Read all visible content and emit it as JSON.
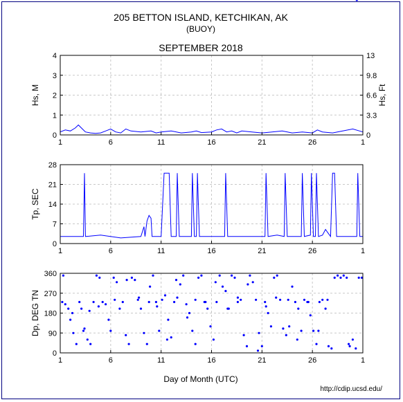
{
  "header": {
    "station": "205 BETTON ISLAND, KETCHIKAN, AK",
    "subtitle": "(BUOY)",
    "month": "SEPTEMBER 2018"
  },
  "footer": {
    "xlabel": "Day of Month (UTC)",
    "url": "http://cdip.ucsd.edu/"
  },
  "colors": {
    "series": "#0000ff",
    "grid": "#c8c8c8",
    "frame": "#000080"
  },
  "chart_data": [
    {
      "type": "line",
      "name": "hs",
      "ylabel": "Hs, M",
      "ylabel_right": "Hs, Ft",
      "ylim": [
        0,
        4
      ],
      "yticks": [
        "0",
        "1",
        "2",
        "3",
        "4"
      ],
      "yticks_right": [
        "0",
        "3.3",
        "6.6",
        "9.8",
        "13"
      ],
      "xlim": [
        1,
        31
      ],
      "xticks": [
        "1",
        "6",
        "11",
        "16",
        "21",
        "26",
        "1"
      ],
      "grid": true,
      "x": [
        1,
        1.5,
        2,
        2.5,
        2.8,
        3.2,
        3.5,
        4,
        4.5,
        5,
        5.5,
        6,
        6.5,
        7,
        7.5,
        8,
        9,
        10,
        10.5,
        11,
        12,
        13,
        14,
        14.5,
        15,
        16,
        16.5,
        17,
        17.5,
        18,
        18.5,
        19,
        20,
        21,
        22,
        23,
        24,
        25,
        26,
        26.5,
        27,
        28,
        29,
        30,
        31
      ],
      "y": [
        0.15,
        0.25,
        0.2,
        0.35,
        0.5,
        0.3,
        0.15,
        0.1,
        0.08,
        0.1,
        0.2,
        0.3,
        0.15,
        0.1,
        0.3,
        0.2,
        0.15,
        0.2,
        0.1,
        0.15,
        0.2,
        0.1,
        0.15,
        0.2,
        0.12,
        0.15,
        0.25,
        0.3,
        0.15,
        0.2,
        0.1,
        0.2,
        0.15,
        0.1,
        0.15,
        0.2,
        0.1,
        0.15,
        0.1,
        0.25,
        0.15,
        0.1,
        0.2,
        0.3,
        0.15
      ]
    },
    {
      "type": "line",
      "name": "tp",
      "ylabel": "Tp, SEC",
      "ylim": [
        0,
        28
      ],
      "yticks": [
        "0",
        "7",
        "14",
        "21",
        "28"
      ],
      "xlim": [
        1,
        31
      ],
      "xticks": [
        "1",
        "6",
        "11",
        "16",
        "21",
        "26",
        "1"
      ],
      "grid": true,
      "x": [
        1,
        3.3,
        3.4,
        3.5,
        5,
        7,
        9,
        9.3,
        9.4,
        9.6,
        9.8,
        10,
        10.1,
        10.3,
        11,
        11.3,
        11.4,
        11.6,
        11.8,
        12,
        12.5,
        12.6,
        12.8,
        13.5,
        14,
        14.1,
        14.3,
        14.5,
        14.6,
        14.8,
        16,
        17.3,
        17.4,
        17.6,
        19,
        21,
        21.3,
        21.4,
        21.6,
        22.5,
        23.2,
        23.3,
        23.5,
        24.2,
        24.5,
        24.9,
        25,
        25.2,
        25.8,
        25.9,
        26.1,
        26.3,
        26.4,
        26.6,
        27,
        27.3,
        27.5,
        27.8,
        28,
        28.1,
        28.2,
        28.4,
        29.5,
        30.4,
        30.5,
        30.7,
        31
      ],
      "y": [
        2.5,
        2.5,
        25,
        2.5,
        3,
        2,
        2.5,
        6,
        2.5,
        8,
        10,
        9,
        2.5,
        2.5,
        2.5,
        25,
        25,
        25,
        25,
        2.5,
        2.5,
        25,
        2.5,
        2.5,
        2.5,
        25,
        2.5,
        2.5,
        25,
        2.5,
        2.5,
        2.5,
        25,
        2.5,
        2.5,
        2.5,
        2.5,
        25,
        2.5,
        3,
        2.5,
        25,
        2.5,
        2.5,
        2.5,
        2.5,
        25,
        2.5,
        3,
        25,
        2.5,
        2.5,
        25,
        2.5,
        3,
        5,
        4,
        2.5,
        25,
        25,
        25,
        2.5,
        2.5,
        2.5,
        25,
        2.5,
        2.5
      ]
    },
    {
      "type": "scatter",
      "name": "dp",
      "ylabel": "Dp, DEG TN",
      "ylim": [
        0,
        360
      ],
      "yticks": [
        "0",
        "90",
        "180",
        "270",
        "360"
      ],
      "xlim": [
        1,
        31
      ],
      "xticks": [
        "1",
        "6",
        "11",
        "16",
        "21",
        "26",
        "1"
      ],
      "grid": true,
      "x": [
        1.2,
        1.5,
        1.8,
        2.0,
        2.3,
        2.6,
        2.9,
        3.1,
        3.4,
        3.7,
        4.0,
        4.3,
        4.6,
        4.9,
        5.2,
        5.5,
        5.8,
        6.0,
        6.3,
        6.6,
        6.9,
        7.2,
        7.5,
        7.8,
        8.1,
        8.4,
        8.7,
        9.0,
        9.3,
        9.6,
        9.9,
        10.2,
        10.5,
        10.8,
        11.1,
        11.4,
        11.7,
        12.0,
        12.3,
        12.6,
        12.9,
        13.2,
        13.5,
        13.8,
        14.1,
        14.4,
        14.7,
        15.0,
        15.3,
        15.6,
        15.9,
        16.2,
        16.5,
        16.8,
        17.1,
        17.4,
        17.7,
        18.0,
        18.3,
        18.6,
        18.9,
        19.2,
        19.5,
        19.8,
        20.1,
        20.4,
        20.7,
        21.0,
        21.3,
        21.6,
        21.9,
        22.2,
        22.5,
        22.8,
        23.1,
        23.4,
        23.7,
        24.0,
        24.3,
        24.6,
        24.9,
        25.2,
        25.5,
        25.8,
        26.1,
        26.4,
        26.7,
        27.0,
        27.3,
        27.6,
        27.9,
        28.2,
        28.5,
        28.8,
        29.1,
        29.4,
        29.7,
        30.0,
        30.3,
        30.6,
        30.9,
        1.3,
        2.2,
        3.3,
        3.9,
        4.8,
        6.4,
        7.6,
        8.8,
        9.8,
        10.6,
        11.6,
        12.5,
        13.6,
        14.4,
        15.4,
        16.4,
        17.6,
        18.6,
        19.6,
        20.6,
        21.4,
        22.4,
        23.6,
        24.5,
        25.6,
        26.6,
        27.5,
        29.6,
        30.4
      ],
      "y": [
        230,
        220,
        200,
        150,
        90,
        40,
        230,
        200,
        110,
        60,
        40,
        230,
        350,
        340,
        230,
        220,
        150,
        100,
        340,
        320,
        200,
        230,
        80,
        40,
        340,
        330,
        240,
        200,
        90,
        40,
        300,
        350,
        230,
        100,
        240,
        260,
        150,
        70,
        230,
        250,
        310,
        350,
        220,
        180,
        100,
        40,
        340,
        350,
        230,
        200,
        120,
        60,
        230,
        350,
        300,
        280,
        200,
        350,
        340,
        250,
        240,
        80,
        30,
        350,
        320,
        240,
        90,
        30,
        230,
        180,
        120,
        340,
        350,
        240,
        110,
        80,
        120,
        300,
        230,
        200,
        100,
        240,
        230,
        170,
        100,
        40,
        230,
        240,
        200,
        30,
        20,
        340,
        350,
        340,
        350,
        340,
        30,
        60,
        20,
        340,
        340,
        350,
        180,
        100,
        190,
        210,
        240,
        330,
        250,
        230,
        210,
        60,
        330,
        160,
        240,
        230,
        320,
        200,
        230,
        310,
        10,
        210,
        250,
        240,
        60,
        230,
        100,
        240,
        40
      ]
    }
  ]
}
